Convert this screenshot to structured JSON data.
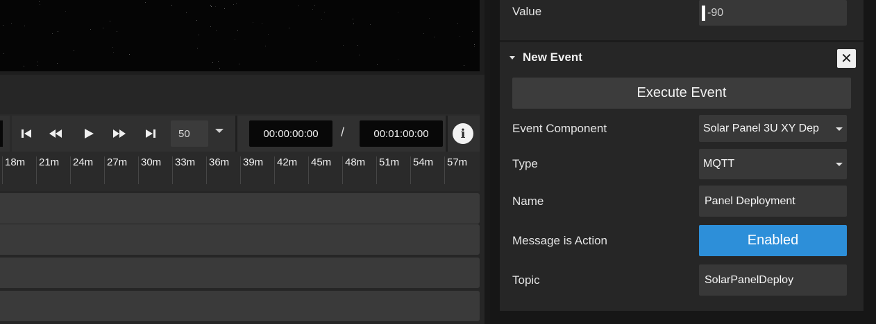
{
  "transport": {
    "speed": "50",
    "current_time": "00:00:00:00",
    "separator": "/",
    "end_time": "00:01:00:00",
    "info_glyph": "i",
    "icons": [
      "skip-to-start-icon",
      "rewind-icon",
      "play-icon",
      "fast-forward-icon",
      "skip-to-end-icon",
      "chevron-down-icon",
      "info-icon"
    ]
  },
  "ruler": {
    "ticks": [
      "18m",
      "21m",
      "24m",
      "27m",
      "30m",
      "33m",
      "36m",
      "39m",
      "42m",
      "45m",
      "48m",
      "51m",
      "54m",
      "57m"
    ]
  },
  "inspector": {
    "value_row": {
      "label": "Value",
      "value": "-90"
    },
    "section": {
      "title": "New Event",
      "close_glyph": "✕",
      "execute_label": "Execute Event",
      "fields": {
        "event_component": {
          "label": "Event Component",
          "value": "Solar Panel 3U XY Dep"
        },
        "type": {
          "label": "Type",
          "value": "MQTT"
        },
        "name": {
          "label": "Name",
          "value": "Panel Deployment"
        },
        "message_is_action": {
          "label": "Message is Action",
          "value": "Enabled"
        },
        "topic": {
          "label": "Topic",
          "value": "SolarPanelDeploy"
        }
      }
    }
  },
  "colors": {
    "accent": "#2d8fd9",
    "panel": "#262626",
    "field": "#383838",
    "viewport": "#050505"
  }
}
